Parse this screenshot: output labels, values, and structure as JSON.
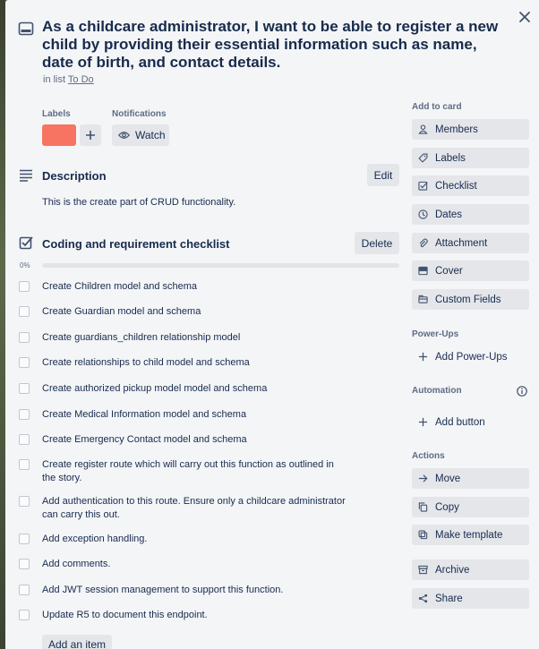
{
  "card": {
    "title": "As a childcare administrator, I want to be able to register a new child by providing their essential information such as name, date of birth, and contact details.",
    "in_list_prefix": "in list",
    "list_name": "To Do"
  },
  "labels_section": {
    "title": "Labels",
    "label_color": "#f87462"
  },
  "notifications_section": {
    "title": "Notifications",
    "watch_label": "Watch"
  },
  "description": {
    "title": "Description",
    "edit_label": "Edit",
    "text": "This is the create part of CRUD functionality."
  },
  "checklist": {
    "title": "Coding and requirement checklist",
    "delete_label": "Delete",
    "progress_text": "0%",
    "progress": 0,
    "items": [
      {
        "text": "Create Children model and schema",
        "checked": false
      },
      {
        "text": "Create Guardian model and schema",
        "checked": false
      },
      {
        "text": "Create guardians_children relationship model",
        "checked": false
      },
      {
        "text": "Create relationships to child model and schema",
        "checked": false
      },
      {
        "text": "Create authorized pickup model model and schema",
        "checked": false
      },
      {
        "text": "Create Medical Information model and schema",
        "checked": false
      },
      {
        "text": "Create Emergency Contact model and schema",
        "checked": false
      },
      {
        "text": "Create register route which will carry out this function as outlined in the story.",
        "checked": false
      },
      {
        "text": "Add authentication to this route. Ensure only a childcare administrator can carry this out.",
        "checked": false
      },
      {
        "text": "Add exception handling.",
        "checked": false
      },
      {
        "text": "Add comments.",
        "checked": false
      },
      {
        "text": "Add JWT session management to support this function.",
        "checked": false
      },
      {
        "text": "Update R5 to document this endpoint.",
        "checked": false
      }
    ],
    "add_item_label": "Add an item"
  },
  "sidebar": {
    "add_to_card_title": "Add to card",
    "add_to_card": [
      {
        "label": "Members",
        "icon": "person-icon"
      },
      {
        "label": "Labels",
        "icon": "tag-icon"
      },
      {
        "label": "Checklist",
        "icon": "checkbox-icon"
      },
      {
        "label": "Dates",
        "icon": "clock-icon"
      },
      {
        "label": "Attachment",
        "icon": "paperclip-icon"
      },
      {
        "label": "Cover",
        "icon": "cover-icon"
      },
      {
        "label": "Custom Fields",
        "icon": "custom-fields-icon"
      }
    ],
    "powerups_title": "Power-Ups",
    "add_powerups_label": "Add Power-Ups",
    "automation_title": "Automation",
    "add_button_label": "Add button",
    "actions_title": "Actions",
    "actions": [
      {
        "label": "Move",
        "icon": "arrow-right-icon"
      },
      {
        "label": "Copy",
        "icon": "copy-icon"
      },
      {
        "label": "Make template",
        "icon": "template-icon"
      },
      {
        "label": "Archive",
        "icon": "archive-icon"
      },
      {
        "label": "Share",
        "icon": "share-icon"
      }
    ]
  }
}
